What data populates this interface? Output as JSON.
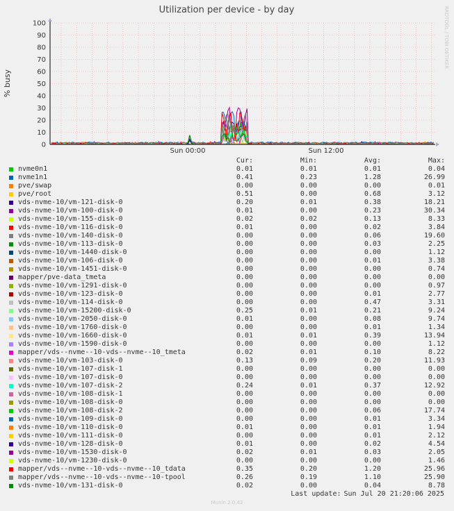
{
  "chart_data": {
    "type": "line",
    "title": "Utilization per device - by day",
    "ylabel": "% busy",
    "ylim": [
      0,
      100
    ],
    "yticks": [
      0,
      10,
      20,
      30,
      40,
      50,
      60,
      70,
      80,
      90,
      100
    ],
    "x_tick_labels": [
      "Sun 00:00",
      "Sun 12:00"
    ],
    "side_text": "RRDTOOL / TOBI OETIKER",
    "columns": [
      "Cur:",
      "Min:",
      "Avg:",
      "Max:"
    ],
    "series": [
      {
        "name": "nvme0n1",
        "color": "#00cc00",
        "cur": "0.01",
        "min": "0.01",
        "avg": "0.01",
        "max": "0.04"
      },
      {
        "name": "nvme1n1",
        "color": "#0066b3",
        "cur": "0.41",
        "min": "0.23",
        "avg": "1.28",
        "max": "26.99"
      },
      {
        "name": "pve/swap",
        "color": "#ff8000",
        "cur": "0.00",
        "min": "0.00",
        "avg": "0.00",
        "max": "0.01"
      },
      {
        "name": "pve/root",
        "color": "#ffcc00",
        "cur": "0.51",
        "min": "0.00",
        "avg": "0.68",
        "max": "3.12"
      },
      {
        "name": "vds-nvme-10/vm-121-disk-0",
        "color": "#330099",
        "cur": "0.20",
        "min": "0.01",
        "avg": "0.38",
        "max": "18.21"
      },
      {
        "name": "vds-nvme-10/vm-100-disk-0",
        "color": "#990099",
        "cur": "0.01",
        "min": "0.00",
        "avg": "0.23",
        "max": "30.34"
      },
      {
        "name": "vds-nvme-10/vm-155-disk-0",
        "color": "#ccff00",
        "cur": "0.02",
        "min": "0.02",
        "avg": "0.13",
        "max": "8.33"
      },
      {
        "name": "vds-nvme-10/vm-116-disk-0",
        "color": "#ff0000",
        "cur": "0.01",
        "min": "0.00",
        "avg": "0.02",
        "max": "3.84"
      },
      {
        "name": "vds-nvme-10/vm-140-disk-0",
        "color": "#808080",
        "cur": "0.00",
        "min": "0.00",
        "avg": "0.06",
        "max": "19.60"
      },
      {
        "name": "vds-nvme-10/vm-113-disk-0",
        "color": "#008f00",
        "cur": "0.00",
        "min": "0.00",
        "avg": "0.03",
        "max": "2.25"
      },
      {
        "name": "vds-nvme-10/vm-1440-disk-0",
        "color": "#00487d",
        "cur": "0.00",
        "min": "0.00",
        "avg": "0.00",
        "max": "1.12"
      },
      {
        "name": "vds-nvme-10/vm-106-disk-0",
        "color": "#b35a00",
        "cur": "0.00",
        "min": "0.00",
        "avg": "0.01",
        "max": "3.38"
      },
      {
        "name": "vds-nvme-10/vm-1451-disk-0",
        "color": "#b38f00",
        "cur": "0.00",
        "min": "0.00",
        "avg": "0.00",
        "max": "0.74"
      },
      {
        "name": "mapper/pve-data_tmeta",
        "color": "#6b006b",
        "cur": "0.00",
        "min": "0.00",
        "avg": "0.00",
        "max": "0.00"
      },
      {
        "name": "vds-nvme-10/vm-1291-disk-0",
        "color": "#8fb300",
        "cur": "0.00",
        "min": "0.00",
        "avg": "0.00",
        "max": "0.97"
      },
      {
        "name": "vds-nvme-10/vm-123-disk-0",
        "color": "#b30000",
        "cur": "0.00",
        "min": "0.00",
        "avg": "0.01",
        "max": "2.77"
      },
      {
        "name": "vds-nvme-10/vm-114-disk-0",
        "color": "#bebebe",
        "cur": "0.00",
        "min": "0.00",
        "avg": "0.47",
        "max": "3.31"
      },
      {
        "name": "vds-nvme-10/vm-15200-disk-0",
        "color": "#80ff80",
        "cur": "0.25",
        "min": "0.01",
        "avg": "0.21",
        "max": "9.24"
      },
      {
        "name": "vds-nvme-10/vm-2050-disk-0",
        "color": "#80c9ff",
        "cur": "0.01",
        "min": "0.00",
        "avg": "0.08",
        "max": "9.74"
      },
      {
        "name": "vds-nvme-10/vm-1760-disk-0",
        "color": "#ffc080",
        "cur": "0.00",
        "min": "0.00",
        "avg": "0.01",
        "max": "1.34"
      },
      {
        "name": "vds-nvme-10/vm-1660-disk-0",
        "color": "#ffe680",
        "cur": "0.01",
        "min": "0.01",
        "avg": "0.39",
        "max": "13.94"
      },
      {
        "name": "vds-nvme-10/vm-1590-disk-0",
        "color": "#aa80ff",
        "cur": "0.00",
        "min": "0.00",
        "avg": "0.00",
        "max": "1.12"
      },
      {
        "name": "mapper/vds--nvme--10-vds--nvme--10_tmeta",
        "color": "#ee00cc",
        "cur": "0.02",
        "min": "0.01",
        "avg": "0.10",
        "max": "8.22"
      },
      {
        "name": "vds-nvme-10/vm-103-disk-0",
        "color": "#ff8080",
        "cur": "0.13",
        "min": "0.09",
        "avg": "0.20",
        "max": "11.93"
      },
      {
        "name": "vds-nvme-10/vm-107-disk-1",
        "color": "#666600",
        "cur": "0.00",
        "min": "0.00",
        "avg": "0.00",
        "max": "0.00"
      },
      {
        "name": "vds-nvme-10/vm-107-disk-0",
        "color": "#ffbfff",
        "cur": "0.00",
        "min": "0.00",
        "avg": "0.00",
        "max": "0.00"
      },
      {
        "name": "vds-nvme-10/vm-107-disk-2",
        "color": "#00ffcc",
        "cur": "0.24",
        "min": "0.01",
        "avg": "0.37",
        "max": "12.92"
      },
      {
        "name": "vds-nvme-10/vm-108-disk-1",
        "color": "#cc6699",
        "cur": "0.00",
        "min": "0.00",
        "avg": "0.00",
        "max": "0.00"
      },
      {
        "name": "vds-nvme-10/vm-108-disk-0",
        "color": "#999900",
        "cur": "0.00",
        "min": "0.00",
        "avg": "0.00",
        "max": "0.00"
      },
      {
        "name": "vds-nvme-10/vm-108-disk-2",
        "color": "#00cc00",
        "cur": "0.00",
        "min": "0.00",
        "avg": "0.06",
        "max": "17.74"
      },
      {
        "name": "vds-nvme-10/vm-109-disk-0",
        "color": "#0066b3",
        "cur": "0.00",
        "min": "0.00",
        "avg": "0.01",
        "max": "3.34"
      },
      {
        "name": "vds-nvme-10/vm-110-disk-0",
        "color": "#ff8000",
        "cur": "0.01",
        "min": "0.00",
        "avg": "0.01",
        "max": "1.94"
      },
      {
        "name": "vds-nvme-10/vm-111-disk-0",
        "color": "#ffcc00",
        "cur": "0.00",
        "min": "0.00",
        "avg": "0.01",
        "max": "2.12"
      },
      {
        "name": "vds-nvme-10/vm-128-disk-0",
        "color": "#330099",
        "cur": "0.01",
        "min": "0.00",
        "avg": "0.02",
        "max": "4.54"
      },
      {
        "name": "vds-nvme-10/vm-1530-disk-0",
        "color": "#990099",
        "cur": "0.02",
        "min": "0.01",
        "avg": "0.03",
        "max": "2.05"
      },
      {
        "name": "vds-nvme-10/vm-1230-disk-0",
        "color": "#ccff00",
        "cur": "0.00",
        "min": "0.00",
        "avg": "0.00",
        "max": "1.46"
      },
      {
        "name": "mapper/vds--nvme--10-vds--nvme--10_tdata",
        "color": "#ff0000",
        "cur": "0.35",
        "min": "0.20",
        "avg": "1.20",
        "max": "25.96"
      },
      {
        "name": "mapper/vds--nvme--10-vds--nvme--10-tpool",
        "color": "#808080",
        "cur": "0.26",
        "min": "0.19",
        "avg": "1.10",
        "max": "25.90"
      },
      {
        "name": "vds-nvme-10/vm-131-disk-0",
        "color": "#008f00",
        "cur": "0.02",
        "min": "0.00",
        "avg": "0.04",
        "max": "8.78"
      }
    ]
  },
  "last_update": {
    "label": "Last update:",
    "value": "Sun Jul 20 21:20:06 2025"
  },
  "footer": "Munin 2.0.42"
}
